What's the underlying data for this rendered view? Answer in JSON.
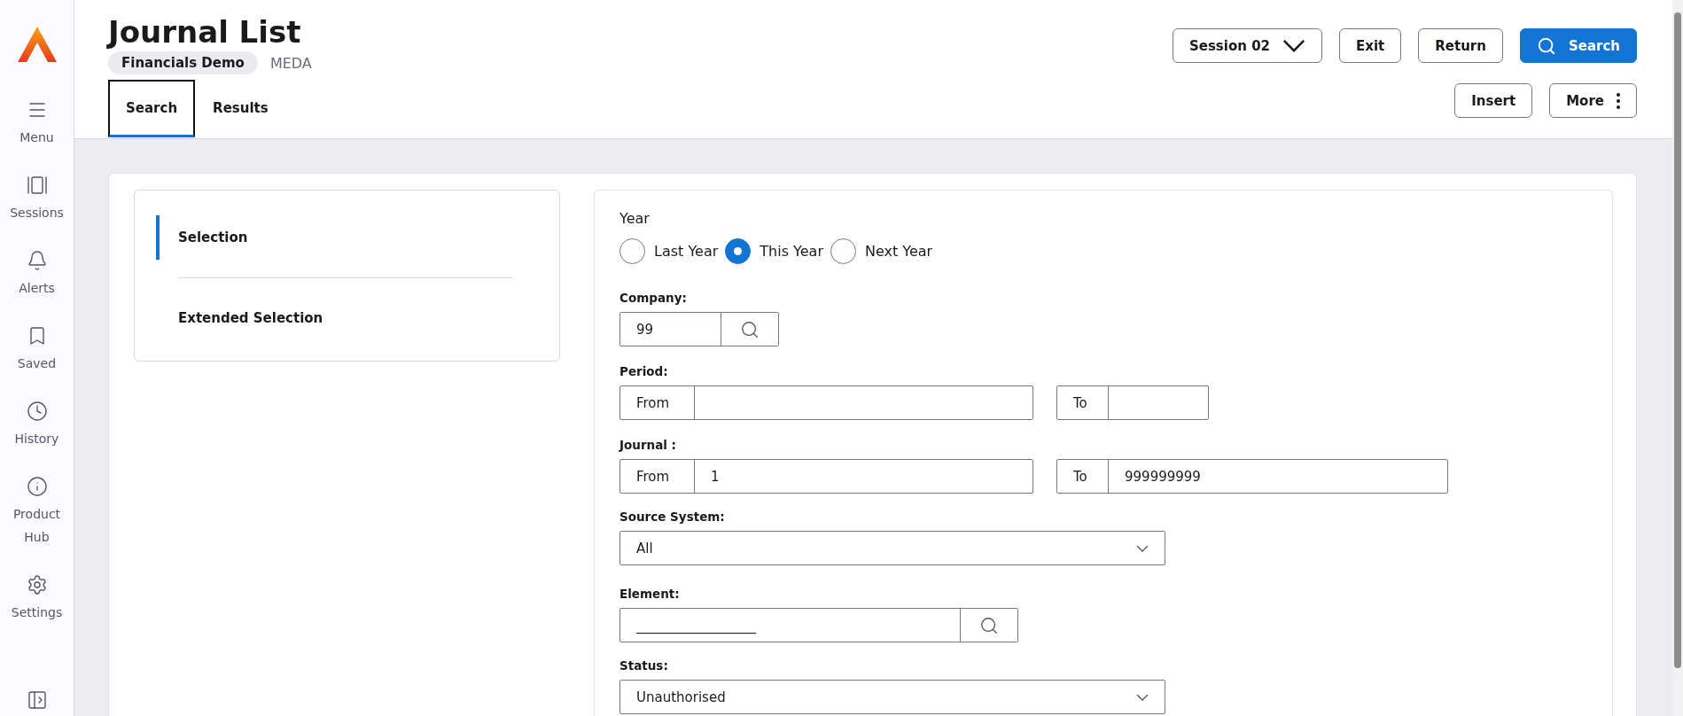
{
  "sidebar": {
    "items": [
      {
        "kind": "menu",
        "label": "Menu"
      },
      {
        "kind": "sessions",
        "label": "Sessions"
      },
      {
        "kind": "alerts",
        "label": "Alerts"
      },
      {
        "kind": "saved",
        "label": "Saved"
      },
      {
        "kind": "history",
        "label": "History"
      },
      {
        "kind": "info",
        "label": "Product Hub"
      },
      {
        "kind": "settings",
        "label": "Settings"
      }
    ]
  },
  "header": {
    "title": "Journal List",
    "context": "Financials Demo",
    "code": "MEDA",
    "tabs": [
      {
        "label": "Search",
        "selected": true
      },
      {
        "label": "Results",
        "selected": false
      }
    ],
    "actions": [
      {
        "kind": "dropdown",
        "label": "Session 02"
      },
      {
        "kind": "plain",
        "label": "Exit"
      },
      {
        "kind": "plain",
        "label": "Return"
      },
      {
        "kind": "primary",
        "label": "Search"
      }
    ],
    "secondary_actions": [
      {
        "kind": "plain",
        "label": "Insert"
      },
      {
        "kind": "more",
        "label": "More"
      }
    ]
  },
  "nav": [
    {
      "label": "Selection",
      "selected": true
    },
    {
      "label": "Extended Selection",
      "selected": false
    }
  ],
  "form": {
    "year": {
      "label": "Year",
      "options": [
        {
          "label": "Last Year",
          "selected": false
        },
        {
          "label": "This Year",
          "selected": true
        },
        {
          "label": "Next Year",
          "selected": false
        }
      ]
    },
    "fields": [
      {
        "kind": "lookup",
        "label": "Company:",
        "value": "99"
      },
      {
        "kind": "range",
        "label": "Period:",
        "from_label": "From",
        "to_label": "To"
      },
      {
        "kind": "range",
        "label": "Journal :",
        "from_label": "From",
        "from_value": "1",
        "to_label": "To",
        "to_value": "999999999"
      },
      {
        "kind": "select",
        "label": "Source System:",
        "value": "All"
      },
      {
        "kind": "lookup",
        "label": "Element:",
        "value": "__________________",
        "wide": true
      },
      {
        "kind": "select",
        "label": "Status:",
        "value": "Unauthorised"
      }
    ]
  }
}
